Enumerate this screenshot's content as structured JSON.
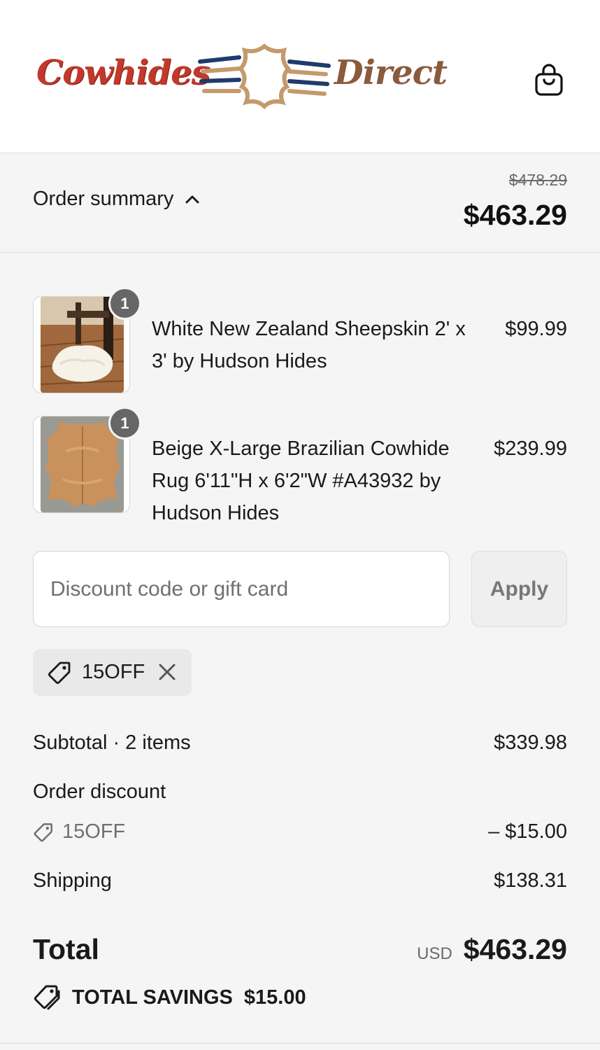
{
  "header": {
    "logo_left": "Cowhides",
    "logo_right": "Direct",
    "cart_icon": "shopping-bag-icon"
  },
  "summary": {
    "toggle_label": "Order summary",
    "toggle_icon": "chevron-up-icon",
    "original_price": "$478.29",
    "price": "$463.29"
  },
  "items": [
    {
      "quantity": "1",
      "name": "White New Zealand Sheepskin 2' x 3' by Hudson Hides",
      "price": "$99.99"
    },
    {
      "quantity": "1",
      "name": "Beige X-Large Brazilian Cowhide Rug 6'11\"H x 6'2\"W #A43932 by Hudson Hides",
      "price": "$239.99"
    }
  ],
  "discount": {
    "placeholder": "Discount code or gift card",
    "apply_label": "Apply",
    "applied_code": "15OFF"
  },
  "totals": {
    "subtotal_label": "Subtotal · 2 items",
    "subtotal_value": "$339.98",
    "order_discount_label": "Order discount",
    "discount_code": "15OFF",
    "discount_value": "– $15.00",
    "shipping_label": "Shipping",
    "shipping_value": "$138.31",
    "total_label": "Total",
    "currency": "USD",
    "total_value": "$463.29",
    "savings_label": "TOTAL SAVINGS",
    "savings_value": "$15.00"
  },
  "colors": {
    "brand_red": "#c0392b",
    "brand_brown": "#8b5a3c",
    "brand_navy": "#1f3a6b",
    "tan": "#c49a6c"
  }
}
